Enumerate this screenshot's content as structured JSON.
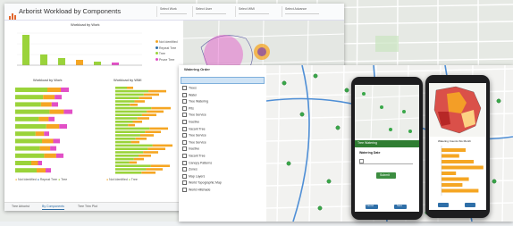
{
  "dashboard": {
    "title": "Arborist Workload by Components",
    "filters": [
      {
        "label": "Select Work"
      },
      {
        "label": "Select User"
      },
      {
        "label": "Select WMI"
      },
      {
        "label": "Select Advance"
      }
    ],
    "top_chart_title": "Workload by Work",
    "left_chart_title": "Workload by Work",
    "right_chart_title": "Workload by WMI",
    "legend": [
      "Not Identified",
      "Repeat Tree",
      "Tree",
      "Prune Tree"
    ],
    "tabs": [
      "Tree Arborist",
      "By Components",
      "Tree Trim Plot"
    ],
    "colors": {
      "accent": "#2f6fa8",
      "green": "#9ad33a",
      "pink": "#e24fc6",
      "orange": "#f5a623",
      "purple": "#7a3fb0",
      "magenta": "#ff2ad4"
    }
  },
  "desktop": {
    "panel_title": "Watering Order",
    "layers": [
      "Trees",
      "Water",
      "Tree Watering",
      "Pits",
      "Tree Service",
      "Inactive",
      "Vacant Tree",
      "Tree Service",
      "Tree Service",
      "Inactive",
      "Vacant Tree",
      "Canopy Patterns",
      "Zones",
      "Map Layers",
      "World Topographic Map",
      "World Hillshade"
    ]
  },
  "phone1": {
    "title": "Tree Watering",
    "field_label": "Watering Date",
    "submit_label": "Submit",
    "footer": [
      "Cancel",
      "Save"
    ],
    "colors": {
      "header": "#2f7d32",
      "button": "#3c8d40"
    }
  },
  "phone2": {
    "title": "Watering Counts this Month",
    "colors": {
      "bar": "#f5a623"
    }
  }
}
